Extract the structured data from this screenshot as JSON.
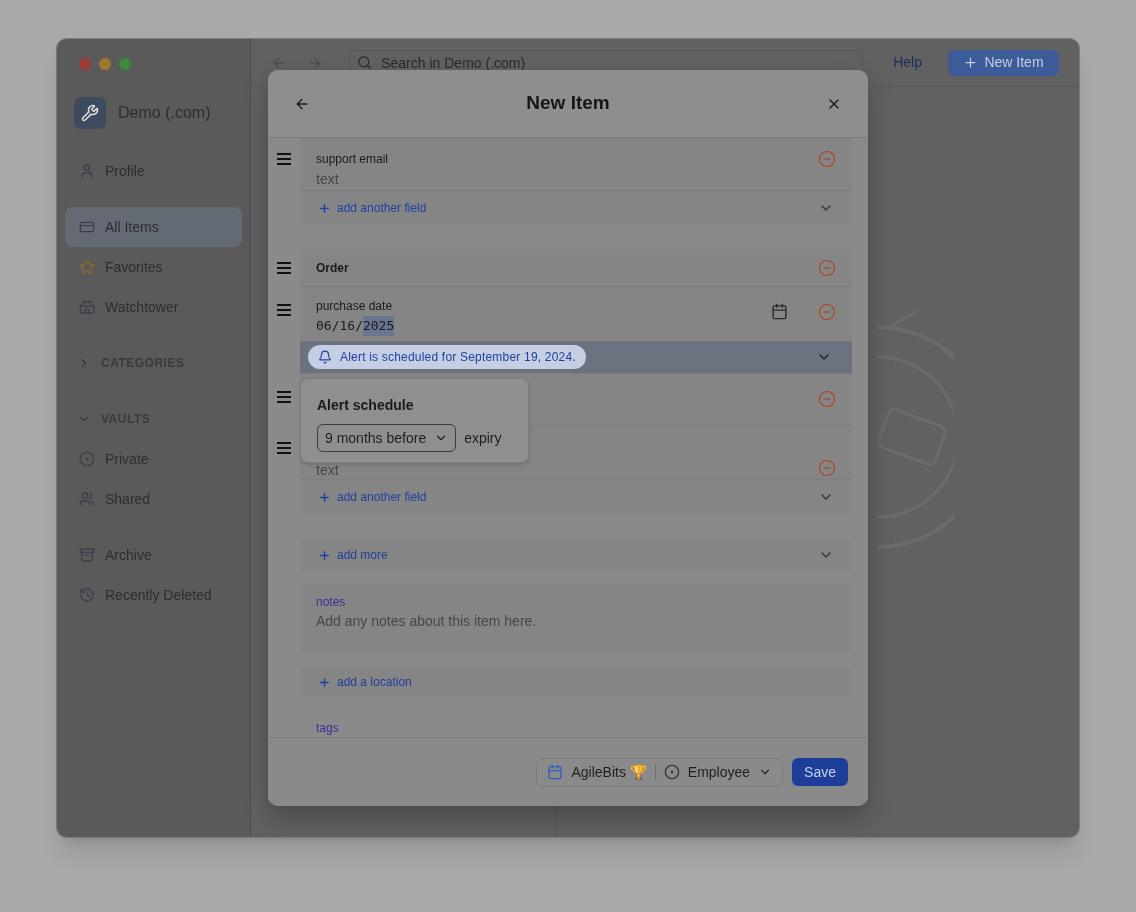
{
  "sidebar": {
    "account": "Demo (.com)",
    "groups": [
      {
        "items": [
          {
            "label": "Profile",
            "selected": false
          }
        ]
      },
      {
        "items": [
          {
            "label": "All Items",
            "selected": true
          },
          {
            "label": "Favorites",
            "selected": false
          },
          {
            "label": "Watchtower",
            "selected": false
          }
        ]
      },
      {
        "heading": "CATEGORIES",
        "expanded": false
      },
      {
        "heading": "VAULTS",
        "expanded": true,
        "items": [
          {
            "label": "Private",
            "selected": false
          },
          {
            "label": "Shared",
            "selected": false
          }
        ]
      },
      {
        "items": [
          {
            "label": "Archive",
            "selected": false
          },
          {
            "label": "Recently Deleted",
            "selected": false
          }
        ]
      }
    ]
  },
  "toolbar": {
    "search": {
      "placeholder": "Search in Demo (.com)"
    },
    "help": "Help",
    "new_item": "New Item"
  },
  "modal": {
    "title": "New Item",
    "sections": [
      {
        "fields": [
          {
            "kind": "text",
            "label": "support email",
            "placeholder": "text"
          }
        ],
        "add": "add another field"
      },
      {
        "title": "Order",
        "fields": [
          {
            "kind": "date",
            "label": "purchase date",
            "value_parts": [
              {
                "text": "06/16/",
                "selected": false
              },
              {
                "text": "2025",
                "selected": true
              }
            ],
            "alert": "Alert is scheduled for September 19, 2024."
          },
          {
            "kind": "covered"
          },
          {
            "kind": "text",
            "placeholder": "text"
          }
        ],
        "add": "add another field"
      }
    ],
    "add_more": "add more",
    "notes": {
      "label": "notes",
      "placeholder": "Add any notes about this item here."
    },
    "add_location": "add a location",
    "tags": {
      "label": "tags"
    },
    "footer": {
      "vault": "AgileBits 🏆",
      "role": "Employee",
      "save": "Save"
    }
  },
  "popover": {
    "title": "Alert schedule",
    "select": "9 months before",
    "suffix": "expiry"
  }
}
